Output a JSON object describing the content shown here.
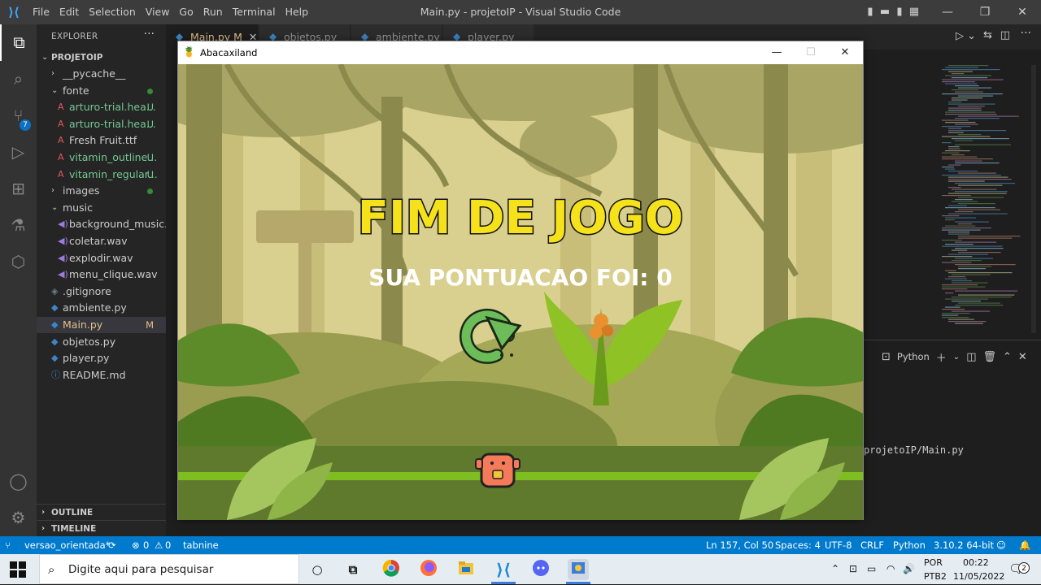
{
  "titlebar": {
    "menus": [
      "File",
      "Edit",
      "Selection",
      "View",
      "Go",
      "Run",
      "Terminal",
      "Help"
    ],
    "title": "Main.py - projetoIP - Visual Studio Code"
  },
  "activity": {
    "scm_badge": "7"
  },
  "explorer": {
    "header": "EXPLORER",
    "project": "PROJETOIP",
    "items": [
      {
        "label": "__pycache__",
        "indent": 1,
        "type": "folder-closed"
      },
      {
        "label": "fonte",
        "indent": 1,
        "type": "folder-open",
        "dot": true
      },
      {
        "label": "arturo-trial.hea...",
        "indent": 2,
        "type": "font",
        "status": "U"
      },
      {
        "label": "arturo-trial.hea...",
        "indent": 2,
        "type": "font",
        "status": "U"
      },
      {
        "label": "Fresh Fruit.ttf",
        "indent": 2,
        "type": "font",
        "status": ""
      },
      {
        "label": "vitamin_outline...",
        "indent": 2,
        "type": "font",
        "status": "U"
      },
      {
        "label": "vitamin_regular...",
        "indent": 2,
        "type": "font",
        "status": "U"
      },
      {
        "label": "images",
        "indent": 1,
        "type": "folder-closed",
        "dot": true
      },
      {
        "label": "music",
        "indent": 1,
        "type": "folder-open"
      },
      {
        "label": "background_music....",
        "indent": 2,
        "type": "audio"
      },
      {
        "label": "coletar.wav",
        "indent": 2,
        "type": "audio"
      },
      {
        "label": "explodir.wav",
        "indent": 2,
        "type": "audio"
      },
      {
        "label": "menu_clique.wav",
        "indent": 2,
        "type": "audio"
      },
      {
        "label": ".gitignore",
        "indent": 1,
        "type": "git"
      },
      {
        "label": "ambiente.py",
        "indent": 1,
        "type": "python"
      },
      {
        "label": "Main.py",
        "indent": 1,
        "type": "python",
        "status": "M",
        "selected": true
      },
      {
        "label": "objetos.py",
        "indent": 1,
        "type": "python"
      },
      {
        "label": "player.py",
        "indent": 1,
        "type": "python"
      },
      {
        "label": "README.md",
        "indent": 1,
        "type": "info"
      }
    ],
    "outline": "OUTLINE",
    "timeline": "TIMELINE"
  },
  "tabs": [
    {
      "label": "Main.py",
      "status": "M",
      "active": true
    },
    {
      "label": "objetos.py"
    },
    {
      "label": "ambiente.py"
    },
    {
      "label": "player.py"
    }
  ],
  "panel": {
    "terminal_type": "Python",
    "terminal_line": "projetoIP/Main.py"
  },
  "game": {
    "window_title": "Abacaxiland",
    "heading": "FIM DE JOGO",
    "score_text": "SUA PONTUACAO FOI: 0"
  },
  "statusbar": {
    "branch": "versao_orientada*",
    "errors": "0",
    "warnings": "0",
    "tabnine": "tabnine",
    "position": "Ln 157, Col 50",
    "spaces": "Spaces: 4",
    "encoding": "UTF-8",
    "eol": "CRLF",
    "language": "Python",
    "interpreter": "3.10.2 64-bit"
  },
  "taskbar": {
    "search_placeholder": "Digite aqui para pesquisar",
    "lang": "POR",
    "layout": "PTB2",
    "time": "00:22",
    "date": "11/05/2022",
    "notifications": "2"
  },
  "colors": {
    "accent": "#007acc",
    "title_yellow": "#f6e21a"
  }
}
